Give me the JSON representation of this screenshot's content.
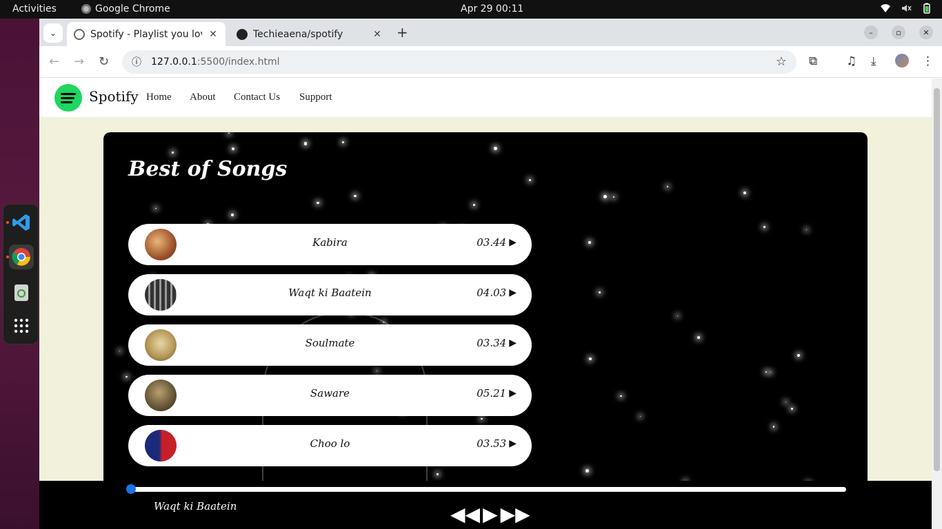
{
  "topbar": {
    "activities": "Activities",
    "app_name": "Google Chrome",
    "clock": "Apr 29  00:11"
  },
  "dock": {
    "items": [
      "vscode-icon",
      "chrome-icon",
      "trash-icon",
      "app-grid-icon"
    ]
  },
  "browser": {
    "tabs": [
      {
        "title": "Spotify - Playlist you love",
        "active": true
      },
      {
        "title": "Techieaena/spotify",
        "active": false
      }
    ],
    "url_host": "127.0.0.1",
    "url_path": ":5500/index.html"
  },
  "site": {
    "brand": "Spotify",
    "nav": [
      "Home",
      "About",
      "Contact Us",
      "Support"
    ],
    "heading": "Best of Songs",
    "songs": [
      {
        "name": "Kabira",
        "duration": "03.44"
      },
      {
        "name": "Waqt ki Baatein",
        "duration": "04.03"
      },
      {
        "name": "Soulmate",
        "duration": "03.34"
      },
      {
        "name": "Saware",
        "duration": "05.21"
      },
      {
        "name": "Choo lo",
        "duration": "03.53"
      }
    ],
    "now_playing": "Waqt ki Baatein",
    "progress": 0,
    "colors": {
      "accent": "#1ed760",
      "page_bg": "#f2f2dc",
      "progress": "#1a73e8"
    }
  }
}
